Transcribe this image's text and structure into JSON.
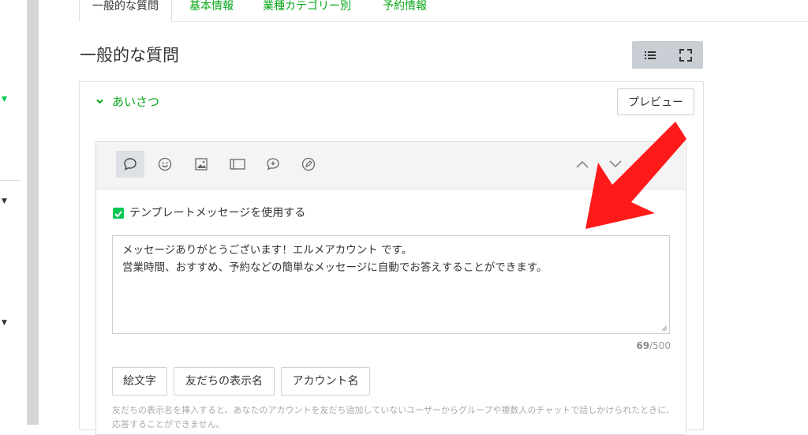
{
  "tabs": [
    {
      "label": "一般的な質問",
      "active": true
    },
    {
      "label": "基本情報",
      "active": false
    },
    {
      "label": "業種カテゴリー別",
      "active": false
    },
    {
      "label": "予約情報",
      "active": false
    }
  ],
  "page_title": "一般的な質問",
  "view_toggle": {
    "list_icon": "list-icon",
    "fullscreen_icon": "fullscreen-icon"
  },
  "accordion": {
    "title": "あいさつ",
    "expanded": true
  },
  "preview_button": "プレビュー",
  "toolbar_icons": [
    "speech-bubble-icon",
    "smile-icon",
    "image-icon",
    "card-icon",
    "chat-plus-icon",
    "edit-icon",
    "chevron-up-icon",
    "chevron-down-icon"
  ],
  "template_checkbox": {
    "checked": true,
    "label": "テンプレートメッセージを使用する"
  },
  "message": {
    "lines": [
      "メッセージありがとうございます！エルメアカウント です。",
      "営業時間、おすすめ、予約などの簡単なメッセージに自動でお答えすることができます。"
    ]
  },
  "char_count": {
    "current": "69",
    "max": "/500"
  },
  "insert_buttons": [
    "絵文字",
    "友だちの表示名",
    "アカウント名"
  ],
  "help_text": "友だちの表示名を挿入すると、あなたのアカウントを友だち追加していないユーザーからグループや複数人のチャットで話しかけられたときに、応答することができません。",
  "colors": {
    "accent": "#06a818",
    "checkbox": "#06c755",
    "arrow": "#ff1a1a"
  }
}
